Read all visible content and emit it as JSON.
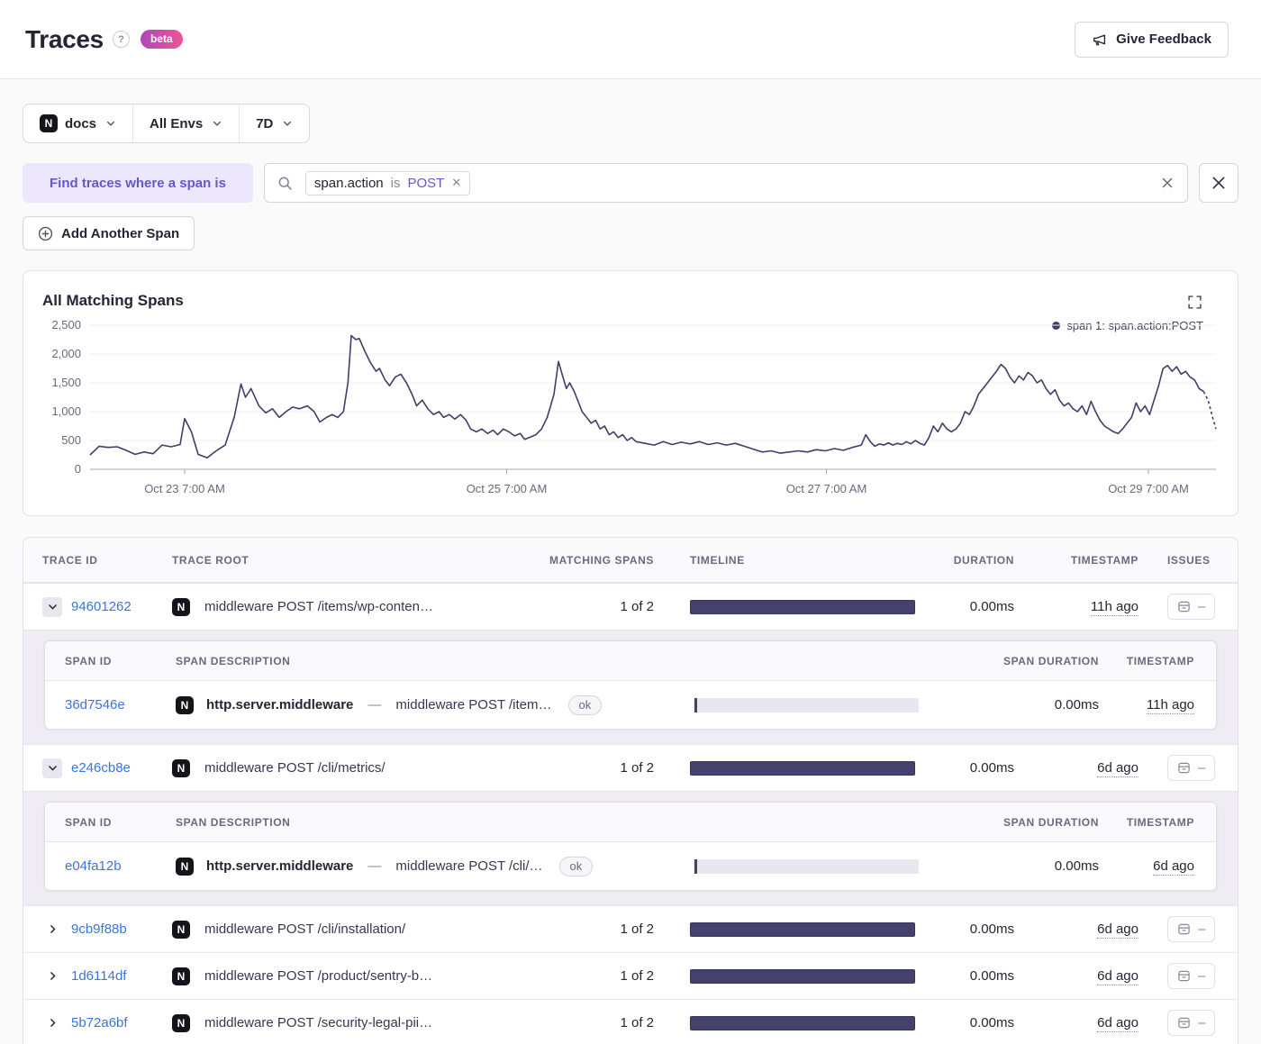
{
  "header": {
    "title": "Traces",
    "beta_label": "beta",
    "feedback_label": "Give Feedback",
    "help_label": "?"
  },
  "icons": {
    "platform_letter": "N"
  },
  "filter_bar": {
    "project": "docs",
    "environment": "All Envs",
    "date_range": "7D"
  },
  "span_search": {
    "find_label": "Find traces where a span is",
    "token_key": "span.action",
    "token_op": "is",
    "token_value": "POST",
    "add_span_label": "Add Another Span"
  },
  "chart_data": {
    "type": "line",
    "title": "All Matching Spans",
    "xlabel": "",
    "ylabel": "",
    "grid": true,
    "legend_position": "top-right",
    "legend": [
      {
        "label": "span 1: span.action:POST",
        "color": "#423e68"
      }
    ],
    "ylim": [
      0,
      2500
    ],
    "yticks": [
      0,
      500,
      1000,
      1500,
      2000,
      2500
    ],
    "ytick_labels": [
      "0",
      "500",
      "1,000",
      "1,500",
      "2,000",
      "2,500"
    ],
    "xtick_labels": [
      "Oct 23 7:00 AM",
      "Oct 25 7:00 AM",
      "Oct 27 7:00 AM",
      "Oct 29 7:00 AM"
    ],
    "xtick_fractions": [
      0.084,
      0.37,
      0.654,
      0.94
    ],
    "series": [
      {
        "name": "span 1: span.action:POST",
        "color": "#423e68",
        "dashed_tail_points": 3,
        "points": [
          [
            0,
            250
          ],
          [
            0.008,
            400
          ],
          [
            0.016,
            380
          ],
          [
            0.024,
            390
          ],
          [
            0.032,
            330
          ],
          [
            0.04,
            260
          ],
          [
            0.048,
            300
          ],
          [
            0.056,
            270
          ],
          [
            0.064,
            420
          ],
          [
            0.072,
            390
          ],
          [
            0.08,
            430
          ],
          [
            0.084,
            880
          ],
          [
            0.09,
            650
          ],
          [
            0.096,
            260
          ],
          [
            0.104,
            200
          ],
          [
            0.112,
            320
          ],
          [
            0.12,
            420
          ],
          [
            0.128,
            900
          ],
          [
            0.134,
            1480
          ],
          [
            0.138,
            1250
          ],
          [
            0.143,
            1400
          ],
          [
            0.15,
            1100
          ],
          [
            0.156,
            980
          ],
          [
            0.162,
            1050
          ],
          [
            0.168,
            900
          ],
          [
            0.174,
            1000
          ],
          [
            0.18,
            1080
          ],
          [
            0.186,
            1050
          ],
          [
            0.193,
            1100
          ],
          [
            0.199,
            1000
          ],
          [
            0.204,
            820
          ],
          [
            0.21,
            900
          ],
          [
            0.215,
            950
          ],
          [
            0.22,
            900
          ],
          [
            0.225,
            1000
          ],
          [
            0.229,
            1500
          ],
          [
            0.232,
            2320
          ],
          [
            0.236,
            2250
          ],
          [
            0.239,
            2270
          ],
          [
            0.244,
            2050
          ],
          [
            0.249,
            1850
          ],
          [
            0.254,
            1700
          ],
          [
            0.257,
            1750
          ],
          [
            0.262,
            1550
          ],
          [
            0.266,
            1450
          ],
          [
            0.271,
            1600
          ],
          [
            0.276,
            1650
          ],
          [
            0.281,
            1500
          ],
          [
            0.286,
            1300
          ],
          [
            0.29,
            1100
          ],
          [
            0.295,
            1200
          ],
          [
            0.3,
            1050
          ],
          [
            0.305,
            950
          ],
          [
            0.31,
            1000
          ],
          [
            0.314,
            900
          ],
          [
            0.319,
            950
          ],
          [
            0.324,
            870
          ],
          [
            0.329,
            950
          ],
          [
            0.334,
            850
          ],
          [
            0.338,
            700
          ],
          [
            0.343,
            650
          ],
          [
            0.348,
            700
          ],
          [
            0.353,
            620
          ],
          [
            0.358,
            680
          ],
          [
            0.362,
            600
          ],
          [
            0.367,
            700
          ],
          [
            0.372,
            650
          ],
          [
            0.377,
            580
          ],
          [
            0.382,
            620
          ],
          [
            0.386,
            520
          ],
          [
            0.391,
            560
          ],
          [
            0.396,
            600
          ],
          [
            0.401,
            700
          ],
          [
            0.406,
            900
          ],
          [
            0.409,
            1100
          ],
          [
            0.412,
            1300
          ],
          [
            0.416,
            1870
          ],
          [
            0.42,
            1600
          ],
          [
            0.423,
            1400
          ],
          [
            0.426,
            1500
          ],
          [
            0.43,
            1350
          ],
          [
            0.433,
            1200
          ],
          [
            0.437,
            1000
          ],
          [
            0.441,
            900
          ],
          [
            0.445,
            800
          ],
          [
            0.449,
            850
          ],
          [
            0.453,
            700
          ],
          [
            0.457,
            750
          ],
          [
            0.461,
            600
          ],
          [
            0.465,
            650
          ],
          [
            0.469,
            550
          ],
          [
            0.473,
            600
          ],
          [
            0.477,
            500
          ],
          [
            0.481,
            550
          ],
          [
            0.485,
            480
          ],
          [
            0.493,
            450
          ],
          [
            0.501,
            420
          ],
          [
            0.509,
            480
          ],
          [
            0.517,
            430
          ],
          [
            0.525,
            470
          ],
          [
            0.533,
            440
          ],
          [
            0.541,
            480
          ],
          [
            0.549,
            430
          ],
          [
            0.557,
            460
          ],
          [
            0.565,
            420
          ],
          [
            0.573,
            450
          ],
          [
            0.581,
            400
          ],
          [
            0.589,
            350
          ],
          [
            0.597,
            300
          ],
          [
            0.605,
            320
          ],
          [
            0.613,
            280
          ],
          [
            0.621,
            300
          ],
          [
            0.629,
            320
          ],
          [
            0.637,
            300
          ],
          [
            0.645,
            340
          ],
          [
            0.653,
            320
          ],
          [
            0.661,
            360
          ],
          [
            0.669,
            330
          ],
          [
            0.677,
            380
          ],
          [
            0.685,
            420
          ],
          [
            0.689,
            600
          ],
          [
            0.693,
            480
          ],
          [
            0.697,
            400
          ],
          [
            0.701,
            440
          ],
          [
            0.705,
            420
          ],
          [
            0.709,
            460
          ],
          [
            0.713,
            420
          ],
          [
            0.717,
            450
          ],
          [
            0.721,
            430
          ],
          [
            0.725,
            480
          ],
          [
            0.729,
            440
          ],
          [
            0.733,
            500
          ],
          [
            0.737,
            450
          ],
          [
            0.741,
            420
          ],
          [
            0.745,
            550
          ],
          [
            0.749,
            750
          ],
          [
            0.753,
            650
          ],
          [
            0.757,
            800
          ],
          [
            0.761,
            700
          ],
          [
            0.765,
            650
          ],
          [
            0.769,
            700
          ],
          [
            0.773,
            800
          ],
          [
            0.777,
            1000
          ],
          [
            0.781,
            950
          ],
          [
            0.785,
            1100
          ],
          [
            0.789,
            1300
          ],
          [
            0.793,
            1400
          ],
          [
            0.797,
            1500
          ],
          [
            0.801,
            1600
          ],
          [
            0.805,
            1700
          ],
          [
            0.809,
            1820
          ],
          [
            0.813,
            1750
          ],
          [
            0.817,
            1600
          ],
          [
            0.821,
            1500
          ],
          [
            0.825,
            1620
          ],
          [
            0.829,
            1550
          ],
          [
            0.833,
            1680
          ],
          [
            0.837,
            1620
          ],
          [
            0.841,
            1500
          ],
          [
            0.845,
            1550
          ],
          [
            0.849,
            1400
          ],
          [
            0.853,
            1300
          ],
          [
            0.857,
            1380
          ],
          [
            0.861,
            1200
          ],
          [
            0.865,
            1100
          ],
          [
            0.869,
            1150
          ],
          [
            0.873,
            1050
          ],
          [
            0.877,
            1000
          ],
          [
            0.881,
            1100
          ],
          [
            0.885,
            950
          ],
          [
            0.889,
            1180
          ],
          [
            0.893,
            1000
          ],
          [
            0.897,
            850
          ],
          [
            0.901,
            750
          ],
          [
            0.905,
            700
          ],
          [
            0.909,
            650
          ],
          [
            0.913,
            620
          ],
          [
            0.917,
            700
          ],
          [
            0.921,
            800
          ],
          [
            0.925,
            900
          ],
          [
            0.929,
            1150
          ],
          [
            0.933,
            1000
          ],
          [
            0.937,
            1100
          ],
          [
            0.941,
            950
          ],
          [
            0.945,
            1200
          ],
          [
            0.949,
            1450
          ],
          [
            0.953,
            1750
          ],
          [
            0.957,
            1800
          ],
          [
            0.961,
            1700
          ],
          [
            0.965,
            1780
          ],
          [
            0.969,
            1650
          ],
          [
            0.973,
            1700
          ],
          [
            0.977,
            1600
          ],
          [
            0.981,
            1550
          ],
          [
            0.985,
            1400
          ],
          [
            0.989,
            1350
          ],
          [
            0.993,
            1200
          ],
          [
            0.997,
            900
          ],
          [
            1,
            700
          ]
        ]
      }
    ]
  },
  "table": {
    "headers": {
      "trace_id": "TRACE ID",
      "trace_root": "TRACE ROOT",
      "matching_spans": "MATCHING SPANS",
      "timeline": "TIMELINE",
      "duration": "DURATION",
      "timestamp": "TIMESTAMP",
      "issues": "ISSUES"
    },
    "span_headers": {
      "span_id": "SPAN ID",
      "span_description": "SPAN DESCRIPTION",
      "span_duration": "SPAN DURATION",
      "timestamp": "TIMESTAMP"
    },
    "issues_empty": "–",
    "desc_separator": "—",
    "rows": [
      {
        "type": "trace",
        "trace_id": "94601262",
        "root": "middleware POST /items/wp-conten…",
        "matching": "1 of 2",
        "duration": "0.00ms",
        "timestamp": "11h ago"
      },
      {
        "type": "span",
        "span_id": "36d7546e",
        "op": "http.server.middleware",
        "desc": "middleware POST /item…",
        "status": "ok",
        "duration": "0.00ms",
        "timestamp": "11h ago"
      },
      {
        "type": "trace",
        "trace_id": "e246cb8e",
        "root": "middleware POST /cli/metrics/",
        "matching": "1 of 2",
        "duration": "0.00ms",
        "timestamp": "6d ago"
      },
      {
        "type": "span",
        "span_id": "e04fa12b",
        "op": "http.server.middleware",
        "desc": "middleware POST /cli/…",
        "status": "ok",
        "duration": "0.00ms",
        "timestamp": "6d ago"
      },
      {
        "type": "trace",
        "trace_id": "9cb9f88b",
        "root": "middleware POST /cli/installation/",
        "matching": "1 of 2",
        "duration": "0.00ms",
        "timestamp": "6d ago"
      },
      {
        "type": "trace",
        "trace_id": "1d6114df",
        "root": "middleware POST /product/sentry-b…",
        "matching": "1 of 2",
        "duration": "0.00ms",
        "timestamp": "6d ago"
      },
      {
        "type": "trace",
        "trace_id": "5b72a6bf",
        "root": "middleware POST /security-legal-pii…",
        "matching": "1 of 2",
        "duration": "0.00ms",
        "timestamp": "6d ago"
      }
    ]
  }
}
